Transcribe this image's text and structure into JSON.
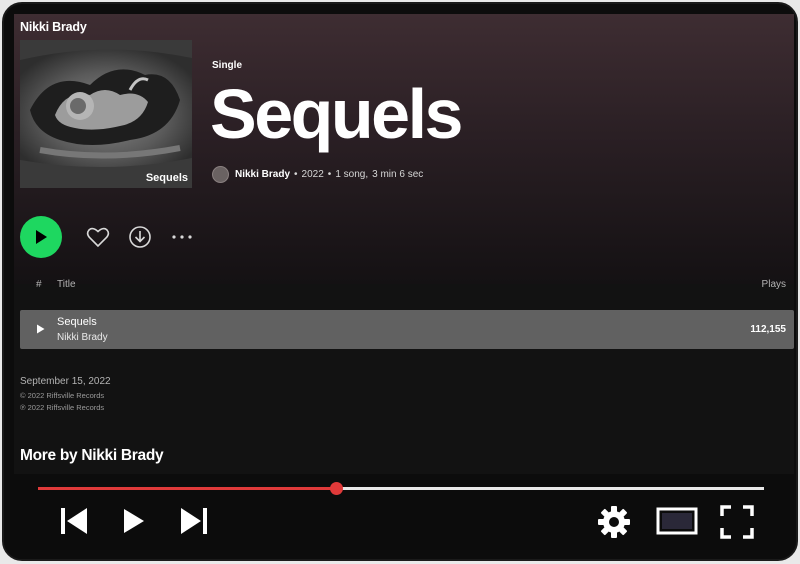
{
  "header": {
    "artist_name": "Nikki Brady"
  },
  "album": {
    "type_label": "Single",
    "title": "Sequels",
    "cover_title": "Sequels",
    "artist": "Nikki Brady",
    "separator": "•",
    "year": "2022",
    "song_count": "1 song,",
    "duration": "3 min 6 sec"
  },
  "tracklist": {
    "header_hash": "#",
    "header_title": "Title",
    "header_plays": "Plays",
    "tracks": [
      {
        "title": "Sequels",
        "artist": "Nikki Brady",
        "plays": "112,155"
      }
    ]
  },
  "footer": {
    "release_date": "September 15, 2022",
    "copyright_1": "© 2022 Riffsville Records",
    "copyright_2": "℗ 2022 Riffsville Records",
    "more_by": "More by Nikki Brady"
  },
  "player": {
    "progress": 0.41,
    "colors": {
      "accent_green": "#1ed760",
      "progress_red": "#e03a3a"
    },
    "icons": [
      "skip-previous-icon",
      "play-icon",
      "skip-next-icon",
      "settings-gear-icon",
      "theater-mode-icon",
      "fullscreen-icon"
    ]
  }
}
